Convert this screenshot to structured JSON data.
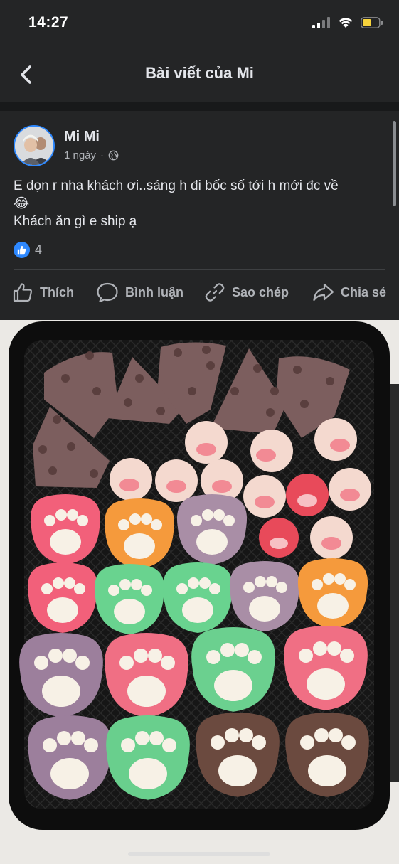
{
  "status": {
    "time": "14:27"
  },
  "nav": {
    "title": "Bài viết của Mi"
  },
  "post": {
    "author": "Mi Mi",
    "time": "1 ngày",
    "separator": "·",
    "text_line1": "E dọn r nha khách ơi..sáng h đi bốc số tới h mới đc về",
    "text_line2": "😂",
    "text_line3": "Khách ăn gì e ship ạ",
    "reaction_count": "4"
  },
  "actions": {
    "like": "Thích",
    "comment": "Bình luận",
    "copy": "Sao chép",
    "share": "Chia sẻ"
  },
  "colors": {
    "background": "#242526",
    "accent": "#2d88ff",
    "text": "#e4e6eb",
    "muted": "#b0b3b8",
    "battery": "#f7d33c"
  },
  "icons": [
    "back-icon",
    "signal-icon",
    "wifi-icon",
    "battery-icon",
    "globe-icon",
    "like-icon",
    "comment-icon",
    "copy-link-icon",
    "share-icon"
  ]
}
